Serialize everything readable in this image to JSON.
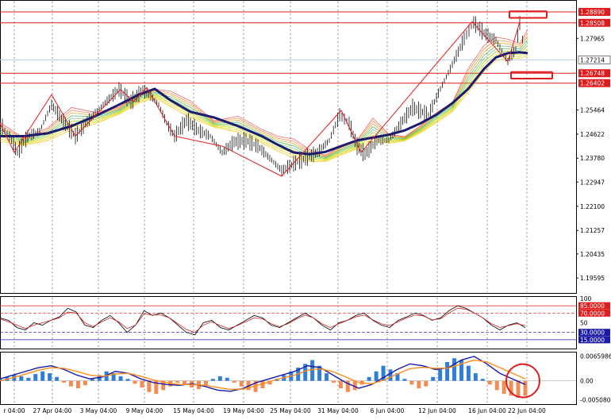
{
  "chart_data": [
    {
      "type": "line",
      "pane": "price",
      "current_price": "1.27214",
      "y_ticks": [
        "1.27965",
        "1.25464",
        "1.24622",
        "1.23780",
        "1.22947",
        "1.22100",
        "1.21257",
        "1.20435",
        "1.19595"
      ],
      "ylim": [
        1.191,
        1.2925
      ],
      "horizontal_levels": [
        {
          "label": "1.28890",
          "value": 1.2889,
          "color": "#e01b1b"
        },
        {
          "label": "1.28508",
          "value": 1.28508,
          "color": "#e01b1b"
        },
        {
          "label": "1.26748",
          "value": 1.26748,
          "color": "#e01b1b"
        },
        {
          "label": "1.26402",
          "value": 1.26402,
          "color": "#e01b1b"
        }
      ],
      "current_price_line_value": 1.27214,
      "price_path": [
        [
          0,
          1.2497
        ],
        [
          12,
          1.2455
        ],
        [
          22,
          1.2398
        ],
        [
          35,
          1.2455
        ],
        [
          50,
          1.2472
        ],
        [
          65,
          1.2565
        ],
        [
          80,
          1.2505
        ],
        [
          95,
          1.2455
        ],
        [
          110,
          1.2505
        ],
        [
          130,
          1.2565
        ],
        [
          150,
          1.2618
        ],
        [
          165,
          1.2575
        ],
        [
          180,
          1.2615
        ],
        [
          190,
          1.2595
        ],
        [
          200,
          1.2565
        ],
        [
          210,
          1.25
        ],
        [
          220,
          1.2455
        ],
        [
          235,
          1.251
        ],
        [
          250,
          1.2475
        ],
        [
          265,
          1.2455
        ],
        [
          280,
          1.2398
        ],
        [
          295,
          1.2435
        ],
        [
          310,
          1.244
        ],
        [
          325,
          1.242
        ],
        [
          340,
          1.2378
        ],
        [
          355,
          1.2335
        ],
        [
          370,
          1.2358
        ],
        [
          385,
          1.2378
        ],
        [
          400,
          1.2398
        ],
        [
          415,
          1.244
        ],
        [
          428,
          1.253
        ],
        [
          440,
          1.25
        ],
        [
          450,
          1.242
        ],
        [
          460,
          1.2392
        ],
        [
          475,
          1.244
        ],
        [
          490,
          1.244
        ],
        [
          505,
          1.25
        ],
        [
          520,
          1.2555
        ],
        [
          540,
          1.253
        ],
        [
          555,
          1.262
        ],
        [
          570,
          1.2705
        ],
        [
          585,
          1.2795
        ],
        [
          597,
          1.2852
        ],
        [
          610,
          1.2815
        ],
        [
          625,
          1.279
        ],
        [
          640,
          1.2715
        ],
        [
          650,
          1.276
        ],
        [
          655,
          1.285
        ],
        [
          662,
          1.2735
        ]
      ],
      "ma_path": [
        [
          0,
          1.2455
        ],
        [
          30,
          1.2455
        ],
        [
          60,
          1.2465
        ],
        [
          90,
          1.249
        ],
        [
          120,
          1.2525
        ],
        [
          150,
          1.2565
        ],
        [
          175,
          1.26
        ],
        [
          195,
          1.262
        ],
        [
          215,
          1.258
        ],
        [
          240,
          1.254
        ],
        [
          270,
          1.252
        ],
        [
          300,
          1.249
        ],
        [
          330,
          1.2455
        ],
        [
          350,
          1.2425
        ],
        [
          370,
          1.2398
        ],
        [
          390,
          1.2392
        ],
        [
          410,
          1.24
        ],
        [
          430,
          1.242
        ],
        [
          450,
          1.244
        ],
        [
          470,
          1.245
        ],
        [
          490,
          1.246
        ],
        [
          510,
          1.2475
        ],
        [
          530,
          1.25
        ],
        [
          550,
          1.253
        ],
        [
          570,
          1.257
        ],
        [
          590,
          1.262
        ],
        [
          610,
          1.269
        ],
        [
          625,
          1.273
        ],
        [
          640,
          1.2745
        ],
        [
          655,
          1.2748
        ],
        [
          665,
          1.2745
        ]
      ],
      "zigzag": [
        [
          0,
          1.25
        ],
        [
          18,
          1.2398
        ],
        [
          65,
          1.26
        ],
        [
          95,
          1.2455
        ],
        [
          152,
          1.2618
        ],
        [
          168,
          1.2575
        ],
        [
          185,
          1.2625
        ],
        [
          220,
          1.2455
        ],
        [
          280,
          1.242
        ],
        [
          355,
          1.2315
        ],
        [
          430,
          1.2545
        ],
        [
          455,
          1.2398
        ],
        [
          595,
          1.2855
        ],
        [
          640,
          1.2715
        ],
        [
          655,
          1.2855
        ]
      ],
      "red_boxes": [
        {
          "name": "upper-target-box",
          "y_top": 1.2891,
          "y_bottom": 1.2868
        },
        {
          "name": "lower-target-box",
          "y_top": 1.2679,
          "y_bottom": 1.2656
        }
      ]
    },
    {
      "type": "line",
      "pane": "stochastic",
      "y_ticks": [
        "100",
        "85.0000",
        "70.0000",
        "50",
        "30.0000",
        "15.0000"
      ],
      "ylim": [
        0,
        100
      ],
      "levels": [
        85,
        70,
        30,
        15
      ],
      "series": [
        {
          "color": "#000000",
          "values": [
            60,
            55,
            40,
            35,
            50,
            45,
            55,
            62,
            80,
            72,
            45,
            40,
            55,
            65,
            50,
            30,
            45,
            75,
            65,
            70,
            60,
            45,
            30,
            25,
            50,
            55,
            40,
            35,
            45,
            55,
            65,
            60,
            45,
            40,
            50,
            60,
            70,
            60,
            45,
            35,
            50,
            55,
            65,
            70,
            55,
            45,
            40,
            55,
            62,
            70,
            65,
            55,
            60,
            75,
            85,
            80,
            70,
            60,
            45,
            35,
            45,
            50,
            40
          ]
        },
        {
          "color": "#cc2222",
          "values": [
            58,
            52,
            45,
            38,
            45,
            50,
            55,
            60,
            72,
            70,
            50,
            42,
            52,
            60,
            52,
            38,
            45,
            68,
            66,
            66,
            60,
            48,
            36,
            30,
            45,
            52,
            44,
            38,
            44,
            52,
            60,
            58,
            48,
            42,
            48,
            58,
            66,
            60,
            48,
            40,
            48,
            55,
            62,
            66,
            56,
            48,
            44,
            52,
            60,
            66,
            64,
            56,
            58,
            70,
            80,
            78,
            70,
            60,
            48,
            40,
            44,
            48,
            44
          ]
        }
      ]
    },
    {
      "type": "bar",
      "pane": "macd",
      "y_ticks": [
        "0.0065986",
        "0.00",
        "-0.0050807"
      ],
      "ylim": [
        -0.0058,
        0.0071
      ],
      "histogram": [
        0.0005,
        0.001,
        0.0015,
        0.0012,
        0.0008,
        0.0018,
        0.0025,
        0.002,
        0.001,
        -0.0005,
        -0.0015,
        -0.002,
        -0.0012,
        0.0005,
        0.0015,
        0.0025,
        0.002,
        0.0012,
        0.0005,
        -0.0008,
        -0.0018,
        -0.003,
        -0.0035,
        -0.0025,
        -0.0015,
        -0.0005,
        -0.001,
        -0.0018,
        -0.0022,
        -0.0012,
        0.0005,
        0.0012,
        0.0008,
        -0.0005,
        -0.0015,
        -0.0025,
        -0.003,
        -0.002,
        -0.001,
        0.0005,
        0.0015,
        0.0025,
        0.0035,
        0.0045,
        0.0055,
        0.004,
        0.002,
        -0.0005,
        -0.002,
        -0.003,
        -0.0025,
        -0.001,
        0.001,
        0.0025,
        0.004,
        0.003,
        0.002,
        0.0005,
        -0.001,
        -0.002,
        -0.0015,
        0.001,
        0.003,
        0.005,
        0.006,
        0.0055,
        0.004,
        0.002,
        0.0005,
        -0.001,
        -0.0025,
        -0.0035,
        -0.004,
        -0.0045,
        -0.004
      ],
      "series": [
        {
          "color": "#1a1aa8",
          "values": [
            0.0005,
            0.0015,
            0.0025,
            0.0035,
            0.004,
            0.003,
            0.0015,
            0.0005,
            0.001,
            0.0025,
            0.002,
            0.0005,
            -0.0005,
            -0.001,
            -0.0012,
            -0.0008,
            -0.0015,
            -0.0025,
            -0.0028,
            -0.002,
            -0.0005,
            0.0005,
            0.0015,
            0.0025,
            0.004,
            0.0035,
            0.0015,
            -0.0005,
            -0.002,
            -0.001,
            0.001,
            0.003,
            0.0045,
            0.004,
            0.003,
            0.0035,
            0.0055,
            0.0065,
            0.0045,
            0.002,
            0.0005,
            -0.001
          ]
        },
        {
          "color": "#ff8c1a",
          "values": [
            0.0,
            0.0008,
            0.0018,
            0.0028,
            0.0035,
            0.0033,
            0.0025,
            0.0015,
            0.0012,
            0.0018,
            0.002,
            0.0012,
            0.0002,
            -0.0005,
            -0.001,
            -0.001,
            -0.0012,
            -0.0018,
            -0.0023,
            -0.0022,
            -0.0013,
            -0.0003,
            0.0007,
            0.0015,
            0.0028,
            0.0032,
            0.0024,
            0.001,
            -0.0005,
            -0.0008,
            0.0002,
            0.0018,
            0.0032,
            0.0036,
            0.0033,
            0.0034,
            0.0045,
            0.0055,
            0.005,
            0.0035,
            0.002,
            0.0005
          ]
        }
      ],
      "circle": {
        "name": "highlight-circle",
        "cx_value": 0.0
      }
    }
  ],
  "x_axis_labels": [
    "r 04:00",
    "27 Apr 04:00",
    "3 May 04:00",
    "9 May 04:00",
    "15 May 04:00",
    "19 May 04:00",
    "25 May 04:00",
    "31 May 04:00",
    "6 Jun 04:00",
    "12 Jun 04:00",
    "16 Jun 04:00",
    "22 Jun 04:00"
  ],
  "colors": {
    "level_red": "#e01b1b",
    "ma_navy": "#1c1c6e",
    "current_price_line": "#b9cbe8",
    "grid": "#000000",
    "hist_pos": "#2f7fd8",
    "hist_neg": "#f28c55"
  }
}
